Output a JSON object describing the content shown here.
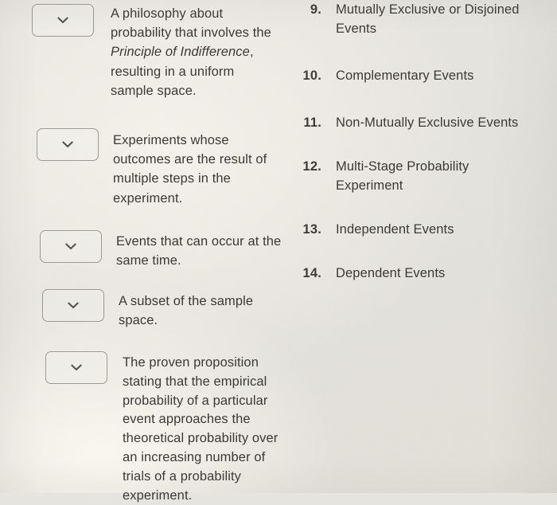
{
  "page": {
    "kind": "matching-exercise-worksheet",
    "background_color": "#e6e4de",
    "text_color": "#3b3a36",
    "box_border_color": "#9c9a93"
  },
  "definitions": [
    {
      "id": "definition-1",
      "dropdown": {
        "value": "",
        "placeholder": "",
        "icon": "chevron-down-icon"
      },
      "text_runs": [
        {
          "text": "A philosophy about probability that involves the ",
          "italic": false
        },
        {
          "text": "Principle of Indifference",
          "italic": true
        },
        {
          "text": ", resulting in a uniform sample space.",
          "italic": false
        }
      ],
      "plain_text": "A philosophy about probability that involves the Principle of Indifference, resulting in a uniform sample space."
    },
    {
      "id": "definition-2",
      "dropdown": {
        "value": "",
        "placeholder": "",
        "icon": "chevron-down-icon"
      },
      "text_runs": [
        {
          "text": "Experiments whose outcomes are the result of multiple steps in the experiment.",
          "italic": false
        }
      ],
      "plain_text": "Experiments whose outcomes are the result of multiple steps in the experiment."
    },
    {
      "id": "definition-3",
      "dropdown": {
        "value": "",
        "placeholder": "",
        "icon": "chevron-down-icon"
      },
      "text_runs": [
        {
          "text": "Events that can occur at the same time.",
          "italic": false
        }
      ],
      "plain_text": "Events that can occur at the same time."
    },
    {
      "id": "definition-4",
      "dropdown": {
        "value": "",
        "placeholder": "",
        "icon": "chevron-down-icon"
      },
      "text_runs": [
        {
          "text": "A subset of the sample space.",
          "italic": false
        }
      ],
      "plain_text": "A subset of the sample space."
    },
    {
      "id": "definition-5",
      "dropdown": {
        "value": "",
        "placeholder": "",
        "icon": "chevron-down-icon"
      },
      "text_runs": [
        {
          "text": "The proven proposition stating that the empirical probability of a particular event approaches the theoretical probability over an increasing number of trials of a probability experiment.",
          "italic": false
        }
      ],
      "plain_text": "The proven proposition stating that the empirical probability of a particular event approaches the theoretical probability over an increasing number of trials of a probability experiment."
    }
  ],
  "terms": [
    {
      "number": "9.",
      "label": "Mutually Exclusive or Disjoined Events"
    },
    {
      "number": "10.",
      "label": "Complementary Events"
    },
    {
      "number": "11.",
      "label": "Non-Mutually Exclusive Events"
    },
    {
      "number": "12.",
      "label": "Multi-Stage Probability Experiment"
    },
    {
      "number": "13.",
      "label": "Independent Events"
    },
    {
      "number": "14.",
      "label": "Dependent Events"
    }
  ]
}
